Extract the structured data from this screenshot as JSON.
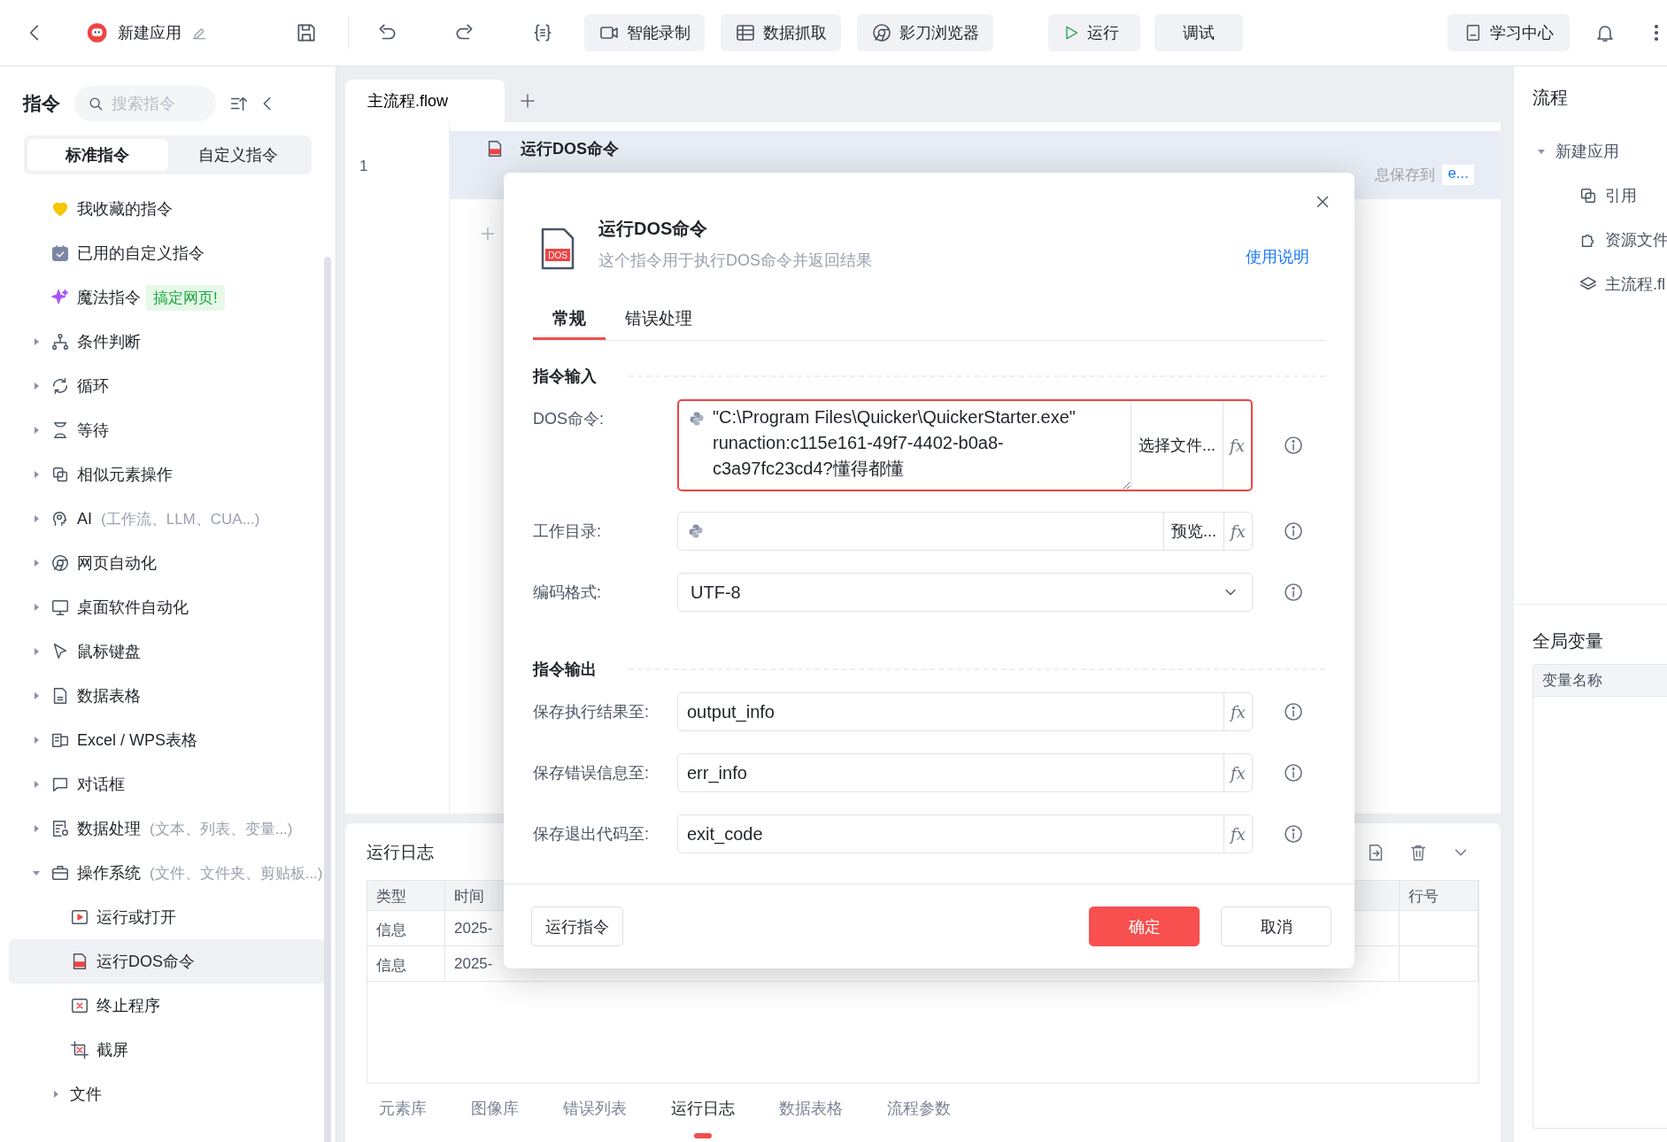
{
  "toolbar": {
    "app_name": "新建应用",
    "buttons": [
      {
        "kind": "record",
        "label": "智能录制"
      },
      {
        "kind": "grab",
        "label": "数据抓取"
      },
      {
        "kind": "browser",
        "label": "影刀浏览器"
      }
    ],
    "run": "运行",
    "debug": "调试",
    "learn": "学习中心"
  },
  "sidebar": {
    "title": "指令",
    "search": {
      "placeholder": "搜索指令"
    },
    "tabs": [
      {
        "label": "标准指令",
        "selected": true
      },
      {
        "label": "自定义指令",
        "selected": false
      }
    ],
    "items": [
      {
        "kind": "shortcut",
        "label": "我收藏的指令",
        "selected": false
      },
      {
        "kind": "shortcut",
        "label": "已用的自定义指令",
        "selected": false
      },
      {
        "kind": "shortcut",
        "label": "魔法指令",
        "badge": "搞定网页!",
        "selected": false
      },
      {
        "kind": "group",
        "label": "条件判断",
        "expanded": false,
        "selected": false
      },
      {
        "kind": "group",
        "label": "循环",
        "expanded": false,
        "selected": false
      },
      {
        "kind": "group",
        "label": "等待",
        "expanded": false,
        "selected": false
      },
      {
        "kind": "group",
        "label": "相似元素操作",
        "expanded": false,
        "selected": false
      },
      {
        "kind": "group",
        "label": "AI",
        "hint": "(工作流、LLM、CUA...)",
        "expanded": false,
        "selected": false
      },
      {
        "kind": "group",
        "label": "网页自动化",
        "expanded": false,
        "selected": false
      },
      {
        "kind": "group",
        "label": "桌面软件自动化",
        "expanded": false,
        "selected": false
      },
      {
        "kind": "group",
        "label": "鼠标键盘",
        "expanded": false,
        "selected": false
      },
      {
        "kind": "group",
        "label": "数据表格",
        "expanded": false,
        "selected": false
      },
      {
        "kind": "group",
        "label": "Excel / WPS表格",
        "expanded": false,
        "selected": false
      },
      {
        "kind": "group",
        "label": "对话框",
        "expanded": false,
        "selected": false
      },
      {
        "kind": "group",
        "label": "数据处理",
        "hint": "(文本、列表、变量...)",
        "expanded": false,
        "selected": false
      },
      {
        "kind": "group",
        "label": "操作系统",
        "hint": "(文件、文件夹、剪贴板...)",
        "expanded": true,
        "selected": false,
        "children": [
          {
            "kind": "command",
            "label": "运行或打开",
            "selected": false
          },
          {
            "kind": "command",
            "label": "运行DOS命令",
            "selected": true
          },
          {
            "kind": "command",
            "label": "终止程序",
            "selected": false
          },
          {
            "kind": "command",
            "label": "截屏",
            "selected": false
          },
          {
            "kind": "group",
            "label": "文件",
            "expanded": false,
            "selected": false
          }
        ]
      }
    ]
  },
  "editor": {
    "tabs": [
      {
        "label": "主流程.flow",
        "selected": true
      }
    ],
    "rows": [
      {
        "line": "1",
        "title": "运行DOS命令",
        "summary": "息保存到",
        "link": "e...",
        "selected": true
      }
    ]
  },
  "dialog": {
    "title": "运行DOS命令",
    "icon_label": "DOS",
    "description": "这个指令用于执行DOS命令并返回结果",
    "help": "使用说明",
    "tabs": [
      {
        "label": "常规",
        "selected": true
      },
      {
        "label": "错误处理",
        "selected": false
      }
    ],
    "sections": [
      {
        "title": "指令输入",
        "fields": [
          {
            "kind": "multiline",
            "label": "DOS命令:",
            "value": "\"C:\\Program Files\\Quicker\\QuickerStarter.exe\" runaction:c115e161-49f7-4402-b0a8-c3a97fc23cd4?懂得都懂",
            "addon": "选择文件...",
            "fx": "fx",
            "invalid": true
          },
          {
            "kind": "path",
            "label": "工作目录:",
            "addon": "预览...",
            "fx": "fx",
            "invalid": false
          },
          {
            "kind": "select",
            "label": "编码格式:",
            "value": "UTF-8",
            "invalid": false
          }
        ]
      },
      {
        "title": "指令输出",
        "fields": [
          {
            "kind": "variable",
            "label": "保存执行结果至:",
            "value": "output_info",
            "fx": "fx",
            "invalid": false
          },
          {
            "kind": "variable",
            "label": "保存错误信息至:",
            "value": "err_info",
            "fx": "fx",
            "invalid": false
          },
          {
            "kind": "variable",
            "label": "保存退出代码至:",
            "value": "exit_code",
            "fx": "fx",
            "invalid": false
          }
        ]
      }
    ],
    "run_button": "运行指令",
    "ok_button": "确定",
    "cancel_button": "取消"
  },
  "log": {
    "title": "运行日志",
    "columns": [
      "类型",
      "时间",
      "行号"
    ],
    "rows": [
      {
        "type": "信息",
        "time": "2025-"
      },
      {
        "type": "信息",
        "time": "2025-"
      }
    ],
    "tabs": [
      {
        "label": "元素库",
        "selected": false
      },
      {
        "label": "图像库",
        "selected": false
      },
      {
        "label": "错误列表",
        "selected": false
      },
      {
        "label": "运行日志",
        "selected": true
      },
      {
        "label": "数据表格",
        "selected": false
      },
      {
        "label": "流程参数",
        "selected": false
      }
    ]
  },
  "flow_panel": {
    "title": "流程",
    "tree": [
      {
        "label": "新建应用",
        "expanded": true,
        "children": [
          {
            "label": "引用"
          },
          {
            "label": "资源文件"
          },
          {
            "label": "主流程.fl"
          }
        ]
      }
    ]
  },
  "variables": {
    "title": "全局变量",
    "columns": [
      "变量名称"
    ]
  }
}
